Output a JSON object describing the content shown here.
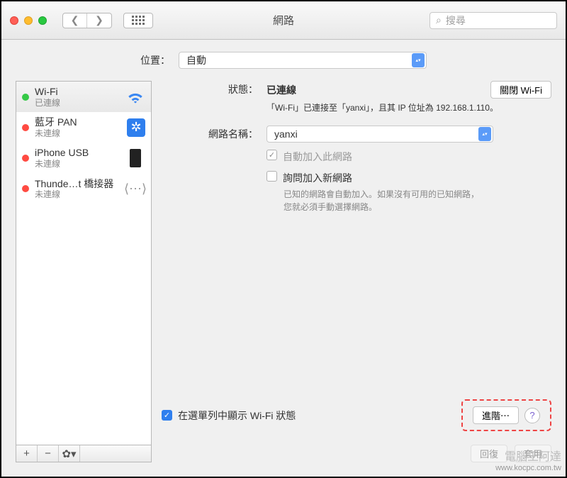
{
  "window": {
    "title": "網路"
  },
  "search": {
    "placeholder": "搜尋"
  },
  "location": {
    "label": "位置：",
    "value": "自動"
  },
  "interfaces": [
    {
      "name": "Wi-Fi",
      "status": "已連線",
      "dot": "g",
      "icon": "wifi",
      "selected": true
    },
    {
      "name": "藍牙 PAN",
      "status": "未連線",
      "dot": "r",
      "icon": "bt",
      "selected": false
    },
    {
      "name": "iPhone USB",
      "status": "未連線",
      "dot": "r",
      "icon": "phone",
      "selected": false
    },
    {
      "name": "Thunde…t 橋接器",
      "status": "未連線",
      "dot": "r",
      "icon": "tb",
      "selected": false
    }
  ],
  "details": {
    "status_label": "狀態：",
    "status_value": "已連線",
    "turn_off": "關閉 Wi-Fi",
    "status_sub": "「Wi-Fi」已連接至「yanxi」，且其 IP 位址為 192.168.1.110。",
    "network_label": "網路名稱：",
    "network_value": "yanxi",
    "auto_join": "自動加入此網路",
    "ask_join": "詢問加入新網路",
    "ask_help": "已知的網路會自動加入。如果沒有可用的已知網路，您就必須手動選擇網路。",
    "show_menu": "在選單列中顯示 Wi-Fi 狀態",
    "advanced": "進階⋯",
    "revert": "回復",
    "apply": "套用"
  },
  "watermark": {
    "line1": "電腦王阿達",
    "line2": "www.kocpc.com.tw"
  }
}
